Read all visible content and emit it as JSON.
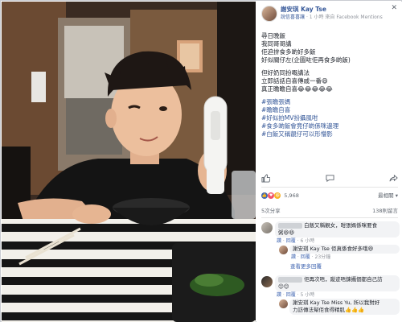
{
  "page": {
    "name": "謝安琪 Kay Tse",
    "meta_poster": "說信喜喜讓",
    "meta_time": "1 小時",
    "meta_suffix": "來自 Facebook Mentions",
    "close_glyph": "✕"
  },
  "post": {
    "paragraphs": [
      [
        "尋日晚飯",
        "我同哥哥講",
        "佢迫拚食多啲好多飯",
        "好似關仔左(企圖咗佢再食多啲飯)"
      ],
      [
        "但好奶同扮嘅講法",
        "立即話話自喜傳戚一番😄",
        "真正瞻瞻自喜😂😂😂😂😂"
      ],
      [
        "#張瞻張媽",
        "#瞻瞻自喜",
        "#好似拍MV扮攝風咁",
        "#食多啲飯會竟仔啲係咪邊理",
        "#白飯又稱靚仔可以形懵影"
      ]
    ]
  },
  "actions": {
    "like_icon": "thumbs-up-icon",
    "comment_icon": "comment-icon",
    "share_icon": "share-icon"
  },
  "reactions": {
    "count": "5,968",
    "sort_label": "最相關 ▾"
  },
  "comments_bar": {
    "left": "5次分享",
    "right": "138則留言"
  },
  "comments": [
    {
      "text": "白飯又稱靚女，咁張媽係咪要食",
      "text2": "粥😆😆",
      "like": "讚",
      "reply": "回覆",
      "time": "6 小時"
    },
    {
      "text": "佢再次唔，蹤迹唔鍊攝個都自己訪",
      "text2": "😌😌",
      "like": "讚",
      "reply": "回覆",
      "time": "5 小時"
    }
  ],
  "replies": [
    {
      "who": "謝安琪 Kay Tse",
      "text": "佢真係食好多哦😆",
      "like": "讚",
      "reply": "回覆",
      "time": "23分鐘"
    },
    {
      "who": "謝安琪 Kay Tse",
      "text": "Miss Yu, 所以我對好",
      "text2": "力訪傳法幫佢食得精肌👍👍👍",
      "like": "讚",
      "reply": "回覆"
    }
  ],
  "more_replies": "查看更多回覆",
  "colors": {
    "link": "#365899",
    "muted": "#90949c",
    "bubble": "#f2f3f5"
  }
}
